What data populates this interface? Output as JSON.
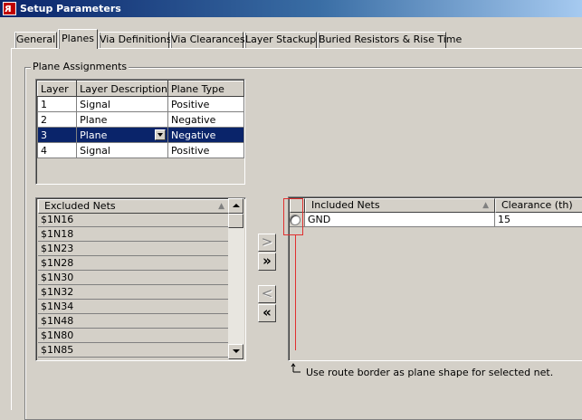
{
  "window": {
    "title": "Setup Parameters"
  },
  "tabs": [
    {
      "label": "General"
    },
    {
      "label": "Planes"
    },
    {
      "label": "Via Definitions"
    },
    {
      "label": "Via Clearances"
    },
    {
      "label": "Layer Stackup"
    },
    {
      "label": "Buried Resistors & Rise Time"
    }
  ],
  "plane_assignments": {
    "group_label": "Plane Assignments",
    "columns": [
      "Layer",
      "Layer Description",
      "Plane Type"
    ],
    "rows": [
      {
        "layer": "1",
        "description": "Signal",
        "type": "Positive"
      },
      {
        "layer": "2",
        "description": "Plane",
        "type": "Negative"
      },
      {
        "layer": "3",
        "description": "Plane",
        "type": "Negative"
      },
      {
        "layer": "4",
        "description": "Signal",
        "type": "Positive"
      }
    ]
  },
  "excluded_nets": {
    "header": "Excluded Nets",
    "items": [
      "$1N16",
      "$1N18",
      "$1N23",
      "$1N28",
      "$1N30",
      "$1N32",
      "$1N34",
      "$1N48",
      "$1N80",
      "$1N85"
    ]
  },
  "buttons": {
    "add": ">",
    "add_all": "»",
    "remove": "<",
    "remove_all": "«"
  },
  "included_nets": {
    "header": "Included Nets",
    "clearance_header": "Clearance (th)",
    "rows": [
      {
        "net": "GND",
        "clearance": "15"
      }
    ]
  },
  "footnote": "Use route border as plane shape for selected net."
}
